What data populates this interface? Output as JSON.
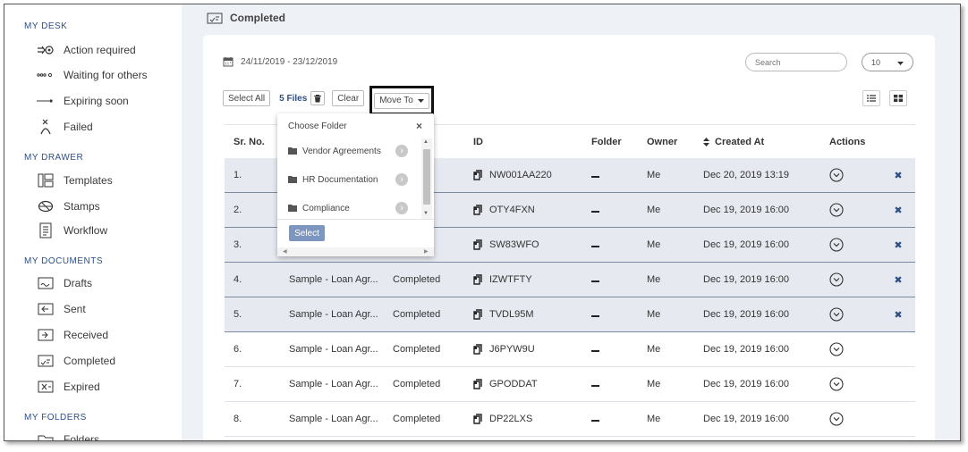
{
  "sidebar": {
    "sections": [
      {
        "title": "MY DESK"
      },
      {
        "title": "MY DRAWER"
      },
      {
        "title": "MY DOCUMENTS"
      },
      {
        "title": "MY FOLDERS"
      }
    ],
    "items": [
      {
        "label": "Action required",
        "icon": "action-required-icon"
      },
      {
        "label": "Waiting for others",
        "icon": "waiting-icon"
      },
      {
        "label": "Expiring soon",
        "icon": "expiring-icon"
      },
      {
        "label": "Failed",
        "icon": "failed-icon"
      },
      {
        "label": "Templates",
        "icon": "templates-icon"
      },
      {
        "label": "Stamps",
        "icon": "stamps-icon"
      },
      {
        "label": "Workflow",
        "icon": "workflow-icon"
      },
      {
        "label": "Drafts",
        "icon": "drafts-icon"
      },
      {
        "label": "Sent",
        "icon": "sent-icon"
      },
      {
        "label": "Received",
        "icon": "received-icon"
      },
      {
        "label": "Completed",
        "icon": "completed-icon"
      },
      {
        "label": "Expired",
        "icon": "expired-icon"
      },
      {
        "label": "Folders",
        "icon": "folders-icon"
      }
    ]
  },
  "header": {
    "title": "Completed"
  },
  "filters": {
    "date_range": "24/11/2019 - 23/12/2019",
    "search_placeholder": "Search",
    "page_size": "10"
  },
  "toolbar": {
    "select_all": "Select All",
    "files_count": "5 Files",
    "clear": "Clear",
    "move_to": "Move To"
  },
  "dropdown": {
    "title": "Choose Folder",
    "close": "×",
    "folders": [
      "Vendor Agreements",
      "HR Documentation",
      "Compliance"
    ],
    "select_label": "Select"
  },
  "table": {
    "columns": [
      "Sr. No.",
      "",
      "",
      "ID",
      "Folder",
      "Owner",
      "Created At",
      "Actions"
    ],
    "rows": [
      {
        "sr": "1.",
        "name": "",
        "status": "ed",
        "id": "NW001AA220",
        "owner": "Me",
        "created": "Dec 20, 2019 13:19",
        "selected": true
      },
      {
        "sr": "2.",
        "name": "",
        "status": "ed",
        "id": "OTY4FXN",
        "owner": "Me",
        "created": "Dec 19, 2019 16:00",
        "selected": true
      },
      {
        "sr": "3.",
        "name": "",
        "status": "ed",
        "id": "SW83WFO",
        "owner": "Me",
        "created": "Dec 19, 2019 16:00",
        "selected": true
      },
      {
        "sr": "4.",
        "name": "Sample - Loan Agr...",
        "status": "Completed",
        "id": "IZWTFTY",
        "owner": "Me",
        "created": "Dec 19, 2019 16:00",
        "selected": true
      },
      {
        "sr": "5.",
        "name": "Sample - Loan Agr...",
        "status": "Completed",
        "id": "TVDL95M",
        "owner": "Me",
        "created": "Dec 19, 2019 16:00",
        "selected": true
      },
      {
        "sr": "6.",
        "name": "Sample - Loan Agr...",
        "status": "Completed",
        "id": "J6PYW9U",
        "owner": "Me",
        "created": "Dec 19, 2019 16:00",
        "selected": false
      },
      {
        "sr": "7.",
        "name": "Sample - Loan Agr...",
        "status": "Completed",
        "id": "GPODDAT",
        "owner": "Me",
        "created": "Dec 19, 2019 16:00",
        "selected": false
      },
      {
        "sr": "8.",
        "name": "Sample - Loan Agr...",
        "status": "Completed",
        "id": "DP22LXS",
        "owner": "Me",
        "created": "Dec 19, 2019 16:00",
        "selected": false
      }
    ]
  },
  "colors": {
    "accent": "#2d4f86",
    "selected_row": "#e6eaf0",
    "select_button": "#7c96bf"
  }
}
